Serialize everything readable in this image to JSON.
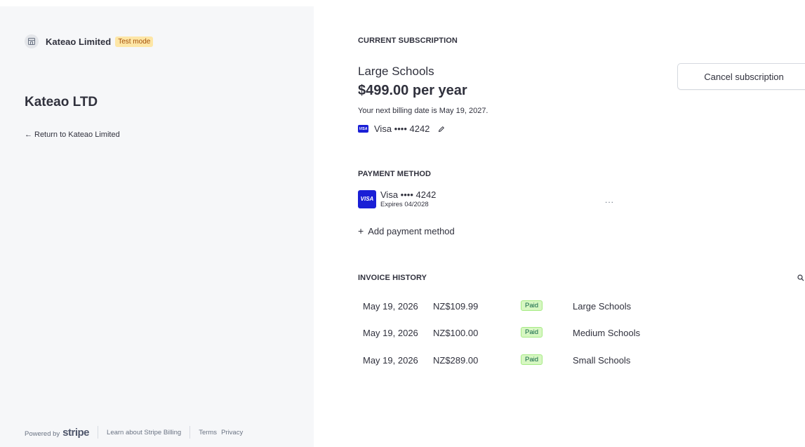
{
  "sidebar": {
    "brand_name": "Kateao Limited",
    "test_badge": "Test mode",
    "company_title": "Kateao LTD",
    "return_link": "Return to Kateao Limited",
    "footer": {
      "powered_by": "Powered by",
      "logo_text": "stripe",
      "learn_link": "Learn about Stripe Billing",
      "terms_link": "Terms",
      "privacy_link": "Privacy"
    }
  },
  "subscription": {
    "heading": "CURRENT SUBSCRIPTION",
    "plan_name": "Large Schools",
    "price": "$499.00 per year",
    "billing_note": "Your next billing date is May 19, 2027.",
    "card_label": "Visa •••• 4242",
    "card_logo_text": "VISA",
    "cancel_label": "Cancel subscription"
  },
  "payment_method": {
    "heading": "PAYMENT METHOD",
    "card_label": "Visa •••• 4242",
    "card_logo_text": "VISA",
    "expiry": "Expires 04/2028",
    "more_label": "...",
    "add_label": "Add payment method"
  },
  "invoice_history": {
    "heading": "INVOICE HISTORY",
    "rows": [
      {
        "date": "May 19, 2026",
        "amount": "NZ$109.99",
        "status": "Paid",
        "plan": "Large Schools"
      },
      {
        "date": "May 19, 2026",
        "amount": "NZ$100.00",
        "status": "Paid",
        "plan": "Medium Schools"
      },
      {
        "date": "May 19, 2026",
        "amount": "NZ$289.00",
        "status": "Paid",
        "plan": "Small Schools"
      }
    ]
  },
  "colors": {
    "sidebar_bg": "#f6f7f9",
    "visa_blue": "#1a1fd6",
    "paid_badge_bg": "#d7f7c2",
    "paid_badge_text": "#0e6245",
    "test_badge_bg": "#fde6a6"
  },
  "icons": {
    "brand": "storefront-icon",
    "back": "left-arrow-icon",
    "edit": "pencil-icon",
    "add": "plus-icon",
    "search": "search-icon"
  }
}
